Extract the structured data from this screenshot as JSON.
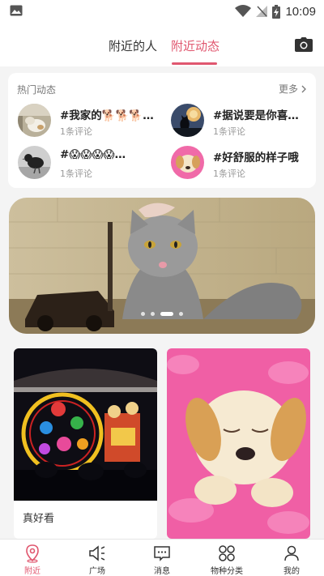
{
  "status_bar": {
    "time": "10:09"
  },
  "top_nav": {
    "tabs": [
      {
        "label": "附近的人",
        "active": false
      },
      {
        "label": "附近动态",
        "active": true
      }
    ]
  },
  "hot_section": {
    "header": "热门动态",
    "more_label": "更多",
    "items": [
      {
        "title": "#我家的🐕🐕🐕…",
        "comments": "1条评论"
      },
      {
        "title": "#据说要是你喜…",
        "comments": "1条评论"
      },
      {
        "title": "#😱😱😱😱…",
        "comments": "1条评论"
      },
      {
        "title": "#好舒服的样子哦",
        "comments": "1条评论"
      }
    ]
  },
  "banner": {
    "dot_count": 4,
    "active_dot": 2
  },
  "feed": [
    {
      "caption": "真好看"
    },
    {
      "caption": ""
    }
  ],
  "bottom_nav": {
    "items": [
      {
        "label": "附近",
        "icon": "location-pin-icon",
        "active": true
      },
      {
        "label": "广场",
        "icon": "speaker-icon",
        "active": false
      },
      {
        "label": "消息",
        "icon": "message-icon",
        "active": false
      },
      {
        "label": "物种分类",
        "icon": "grid-circles-icon",
        "active": false
      },
      {
        "label": "我的",
        "icon": "person-icon",
        "active": false
      }
    ]
  },
  "colors": {
    "accent": "#e0576f",
    "background": "#f4f4f4"
  }
}
